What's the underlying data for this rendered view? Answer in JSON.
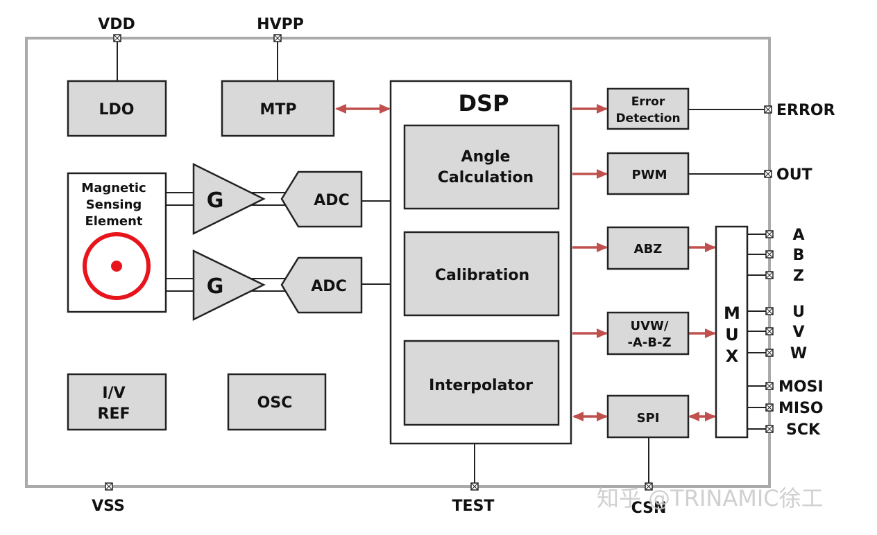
{
  "pins": {
    "vdd": "VDD",
    "hvpp": "HVPP",
    "vss": "VSS",
    "test": "TEST",
    "csn": "CSN",
    "error": "ERROR",
    "out": "OUT",
    "a": "A",
    "b": "B",
    "z": "Z",
    "u": "U",
    "v": "V",
    "w": "W",
    "mosi": "MOSI",
    "miso": "MISO",
    "sck": "SCK"
  },
  "blocks": {
    "ldo": "LDO",
    "mtp": "MTP",
    "sensing": [
      "Magnetic",
      "Sensing",
      "Element"
    ],
    "gain": "G",
    "adc": "ADC",
    "ivref": [
      "I/V",
      "REF"
    ],
    "osc": "OSC",
    "dsp": "DSP",
    "angle": [
      "Angle",
      "Calculation"
    ],
    "calibration": "Calibration",
    "interpolator": "Interpolator",
    "error_detection": [
      "Error",
      "Detection"
    ],
    "pwm": "PWM",
    "abz": "ABZ",
    "uvw": [
      "UVW/",
      "-A-B-Z"
    ],
    "spi": "SPI",
    "mux": [
      "M",
      "U",
      "X"
    ]
  },
  "colors": {
    "arrow": "#c0504d",
    "sensor": "#e8141c",
    "block_fill": "#d9d9d9",
    "border": "#aaaaaa"
  },
  "watermark": "知乎 @TRINAMIC徐工"
}
